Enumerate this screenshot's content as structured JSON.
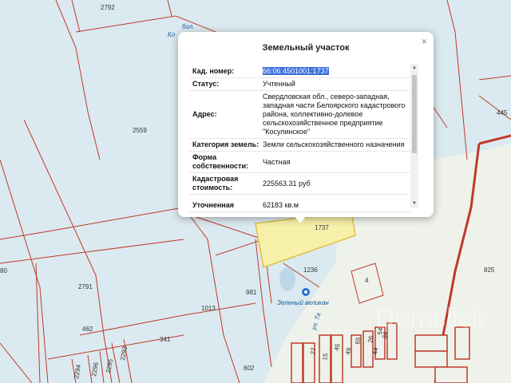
{
  "map": {
    "parcel_numbers": [
      "2792",
      "2559",
      "2791",
      "462",
      "1013",
      "341",
      "2293",
      "2294",
      "2295",
      "2296",
      "981",
      "1236",
      "602",
      "1737",
      "825",
      "445",
      "4",
      "80",
      "54",
      "65",
      "27",
      "15",
      "45",
      "49",
      "26",
      "44",
      "34"
    ],
    "place_labels": [
      "бол.",
      "Кл",
      "Зеленый великан",
      "ул. Та"
    ],
    "watermark": "Domclick"
  },
  "popup": {
    "title": "Земельный участок",
    "close_label": "×",
    "rows": [
      {
        "key": "Кад. номер:",
        "value": "66:06:4501001:1737"
      },
      {
        "key": "Статус:",
        "value": "Учтенный"
      },
      {
        "key": "Адрес:",
        "value": "Свердловская обл., северо-западная, западная части Белоярского кадастрового района, коллективно-долевое сельскохозяйственное предприятие \"Косулинское\""
      },
      {
        "key": "Категория земель:",
        "value": "Земли сельскохозяйственного назначения"
      },
      {
        "key": "Форма собственности:",
        "value": "Частная"
      },
      {
        "key": "Кадастровая стоимость:",
        "value": "225563.31 руб"
      },
      {
        "key": "Уточненная",
        "value": "62183 кв.м"
      }
    ]
  },
  "colors": {
    "parcel_border": "#c0392b",
    "highlight_fill": "#f6f0a8",
    "highlight_border": "#e0c040",
    "water": "#dbeaf0",
    "land": "#eef2ea",
    "selection": "#3b6fd8"
  }
}
